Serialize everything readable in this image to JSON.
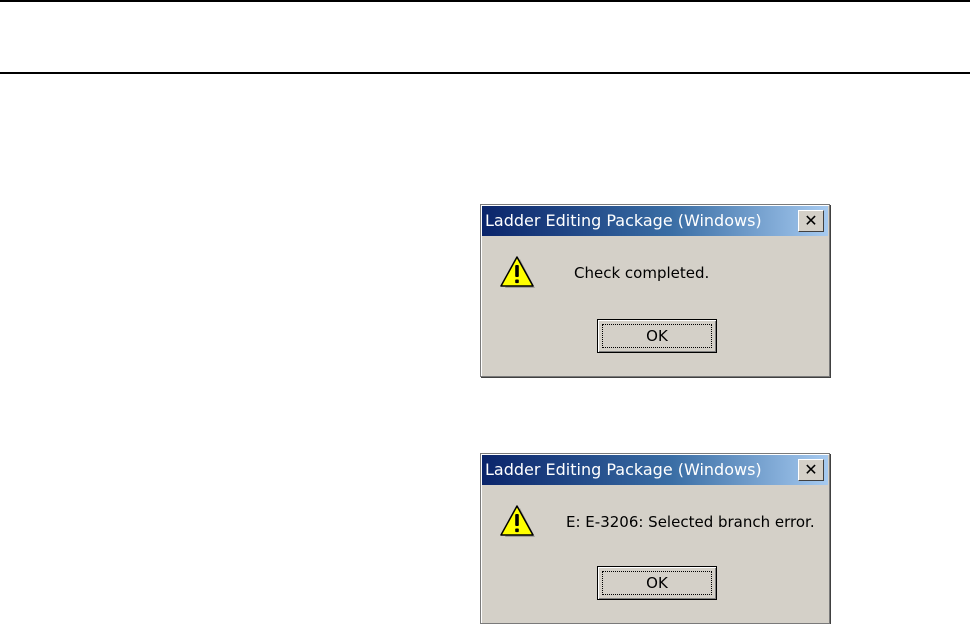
{
  "dialogs": [
    {
      "title": "Ladder Editing Package (Windows)",
      "message": "Check completed.",
      "button_label": "OK",
      "icon": "warning-icon",
      "close_glyph": "✕"
    },
    {
      "title": "Ladder Editing Package (Windows)",
      "message": "E: E-3206: Selected branch error.",
      "button_label": "OK",
      "icon": "warning-icon",
      "close_glyph": "✕"
    }
  ],
  "colors": {
    "titlebar_start": "#0a246a",
    "titlebar_end": "#a6caf0",
    "dialog_face": "#d4d0c8",
    "warning_fill": "#ffff00"
  }
}
